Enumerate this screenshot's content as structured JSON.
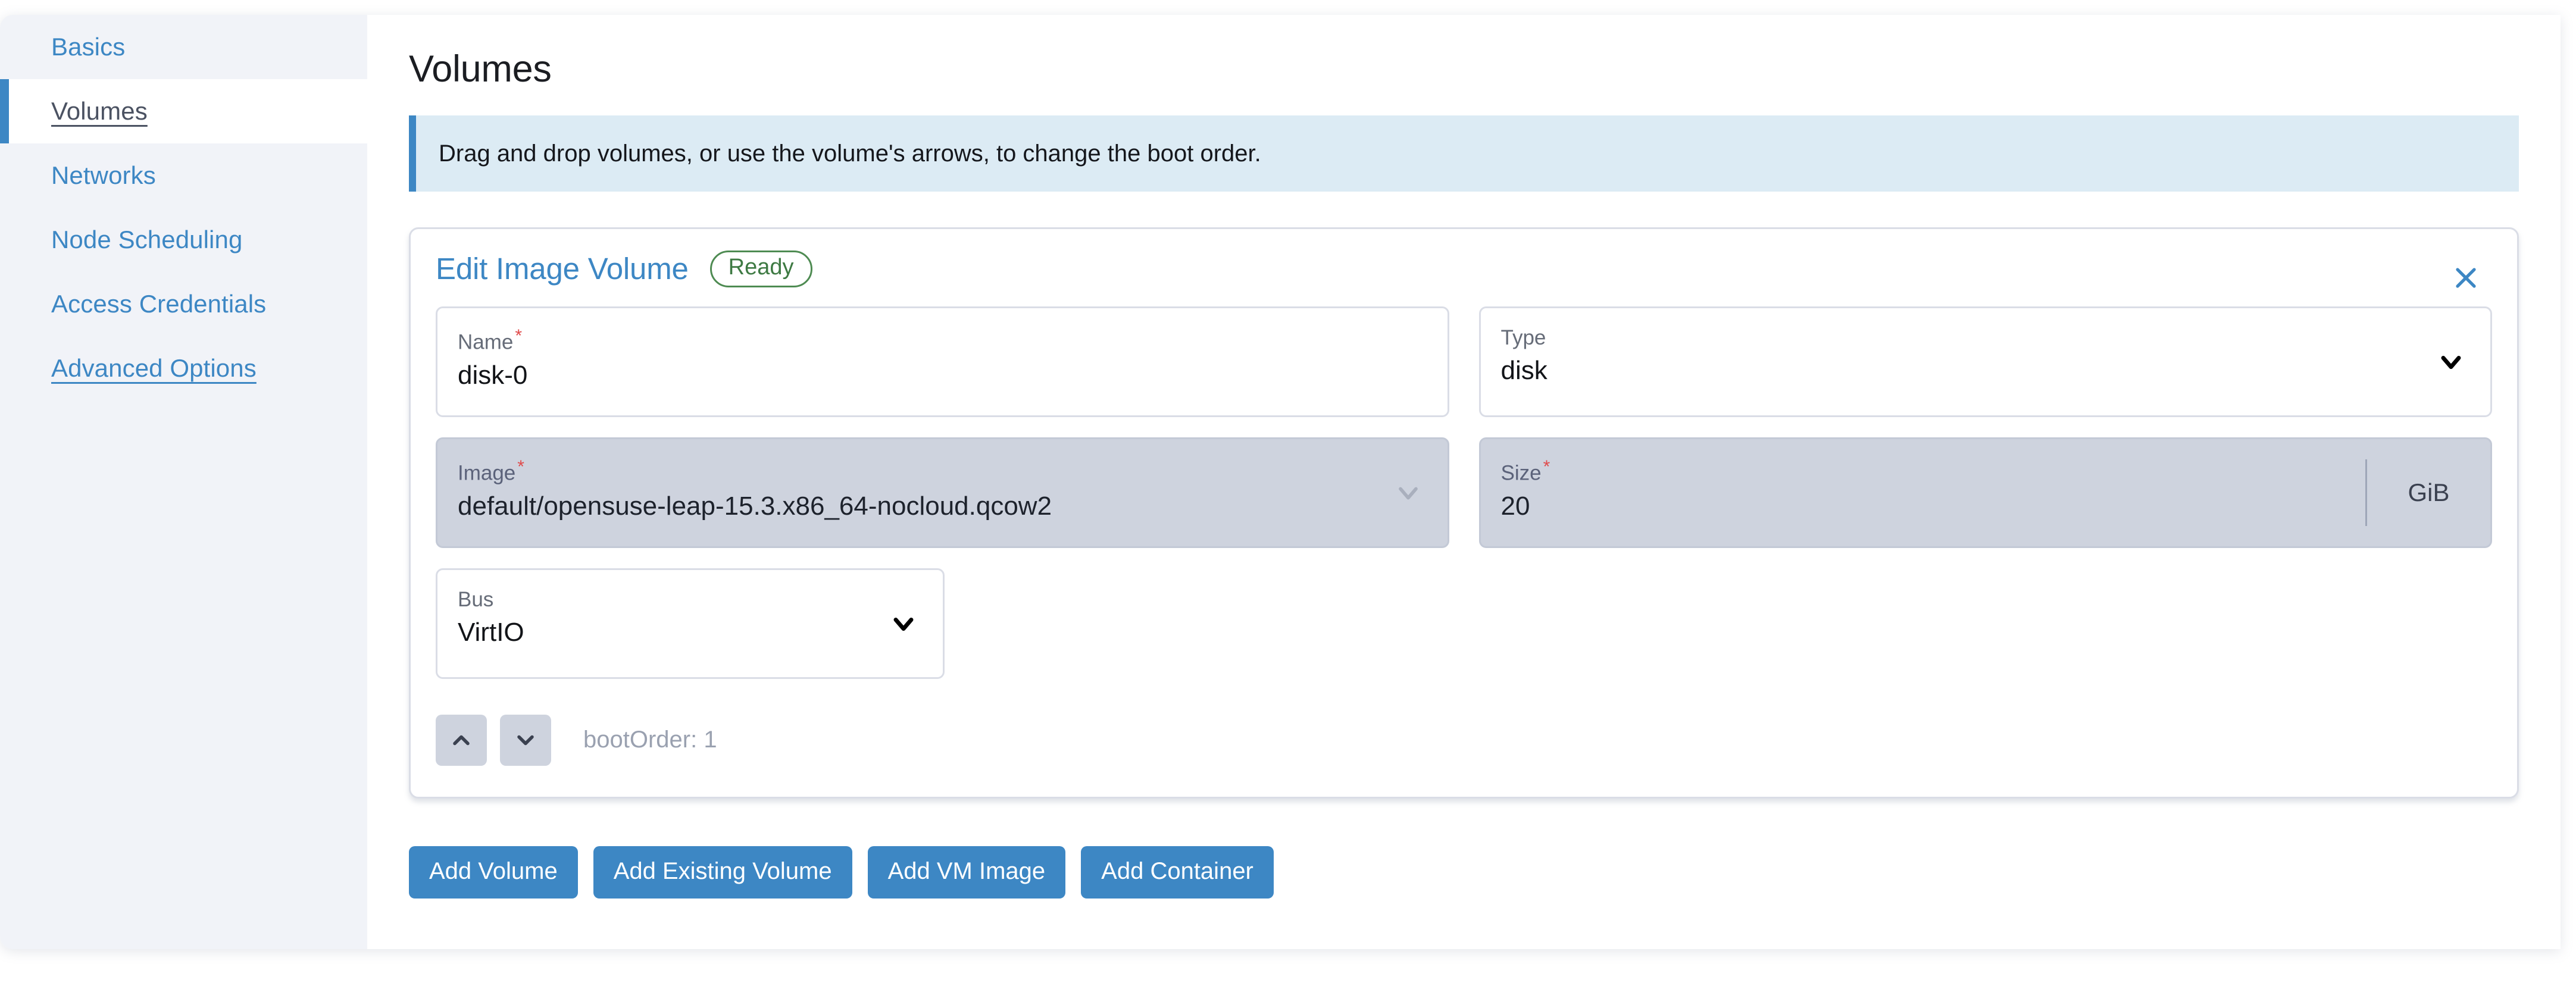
{
  "sidebar": {
    "items": [
      {
        "label": "Basics",
        "active": false,
        "underlined": false
      },
      {
        "label": "Volumes",
        "active": true,
        "underlined": true
      },
      {
        "label": "Networks",
        "active": false,
        "underlined": false
      },
      {
        "label": "Node Scheduling",
        "active": false,
        "underlined": false
      },
      {
        "label": "Access Credentials",
        "active": false,
        "underlined": false
      },
      {
        "label": "Advanced Options",
        "active": false,
        "underlined": true
      }
    ]
  },
  "main": {
    "title": "Volumes",
    "banner": {
      "text": "Drag and drop volumes, or use the volume's arrows, to change the boot order.",
      "accent_color": "#3d87c4",
      "background_color": "#dcebf4"
    }
  },
  "volume_card": {
    "title": "Edit Image Volume",
    "status_badge": "Ready",
    "status_color": "#4e8b52",
    "close_icon": "close-icon",
    "fields": {
      "name": {
        "label": "Name",
        "required": true,
        "value": "disk-0",
        "disabled": false
      },
      "type": {
        "label": "Type",
        "required": false,
        "value": "disk",
        "disabled": false,
        "icon": "chevron-down-icon"
      },
      "image": {
        "label": "Image",
        "required": true,
        "value": "default/opensuse-leap-15.3.x86_64-nocloud.qcow2",
        "disabled": true,
        "icon": "chevron-down-icon"
      },
      "size": {
        "label": "Size",
        "required": true,
        "value": "20",
        "unit": "GiB",
        "disabled": true
      },
      "bus": {
        "label": "Bus",
        "required": false,
        "value": "VirtIO",
        "disabled": false,
        "icon": "chevron-down-icon"
      }
    },
    "boot_order": {
      "up_icon": "chevron-up-icon",
      "down_icon": "chevron-down-icon",
      "text": "bootOrder: 1"
    }
  },
  "actions": {
    "buttons": [
      {
        "label": "Add Volume"
      },
      {
        "label": "Add Existing Volume"
      },
      {
        "label": "Add VM Image"
      },
      {
        "label": "Add Container"
      }
    ],
    "color": "#3d87c4"
  }
}
